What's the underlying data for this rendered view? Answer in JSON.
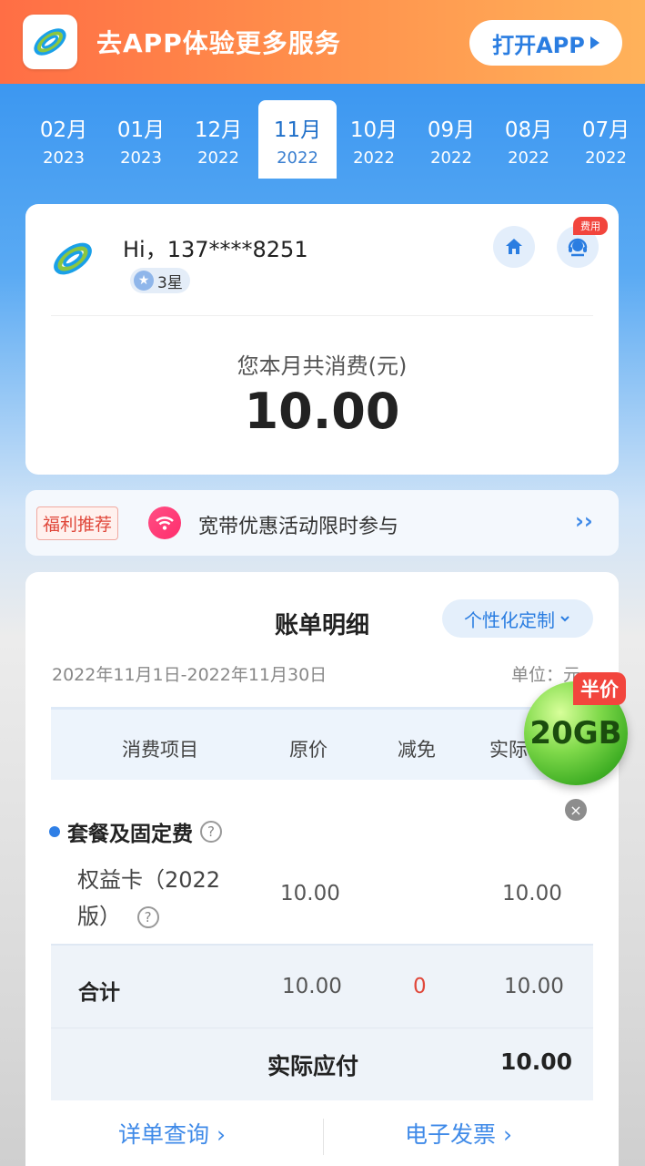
{
  "banner": {
    "text": "去APP体验更多服务",
    "open_button": "打开APP"
  },
  "months": [
    {
      "month": "02月",
      "year": "2023"
    },
    {
      "month": "01月",
      "year": "2023"
    },
    {
      "month": "12月",
      "year": "2022"
    },
    {
      "month": "11月",
      "year": "2022",
      "active": true
    },
    {
      "month": "10月",
      "year": "2022"
    },
    {
      "month": "09月",
      "year": "2022"
    },
    {
      "month": "08月",
      "year": "2022"
    },
    {
      "month": "07月",
      "year": "2022"
    }
  ],
  "user_card": {
    "greeting": "Hi，137****8251",
    "star_level": "3星",
    "fee_tag": "费用",
    "spend_label": "您本月共消费(元)",
    "spend_value": "10.00"
  },
  "promo": {
    "tag": "福利推荐",
    "text": "宽带优惠活动限时参与",
    "arrow": "››"
  },
  "bill": {
    "title": "账单明细",
    "custom_button": "个性化定制",
    "period": "2022年11月1日-2022年11月30日",
    "unit": "单位：元",
    "headers": [
      "消费项目",
      "原价",
      "减免",
      "实际"
    ],
    "section_title": "套餐及固定费",
    "item": {
      "name": "权益卡（2022版）",
      "original": "10.00",
      "actual": "10.00"
    },
    "total": {
      "label": "合计",
      "original": "10.00",
      "discount": "0",
      "actual": "10.00"
    },
    "payable": {
      "label": "实际应付",
      "value": "10.00"
    },
    "links": {
      "detail": "详单查询 ›",
      "invoice": "电子发票 ›"
    }
  },
  "float_promo": {
    "tag": "半价",
    "value": "20GB"
  },
  "colors": {
    "primary_blue": "#2f8ff0",
    "banner_orange": "#ff7a48",
    "accent_red": "#f2453d",
    "link_blue": "#3f8ae8"
  }
}
